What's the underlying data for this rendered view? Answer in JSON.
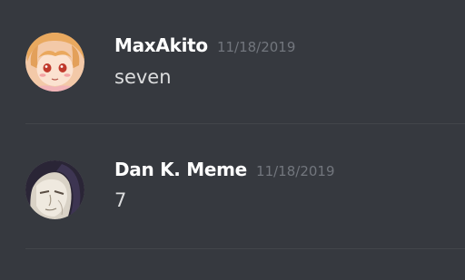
{
  "messages": [
    {
      "username": "MaxAkito",
      "timestamp": "11/18/2019",
      "text": "seven",
      "avatar_icon": "anime-girl-avatar-icon"
    },
    {
      "username": "Dan K. Meme",
      "timestamp": "11/18/2019",
      "text": "7",
      "avatar_icon": "dark-haired-character-avatar-icon"
    }
  ],
  "colors": {
    "background": "#36393f",
    "username": "#ffffff",
    "timestamp": "#72767d",
    "message_text": "#dcddde",
    "divider": "#42454a"
  }
}
